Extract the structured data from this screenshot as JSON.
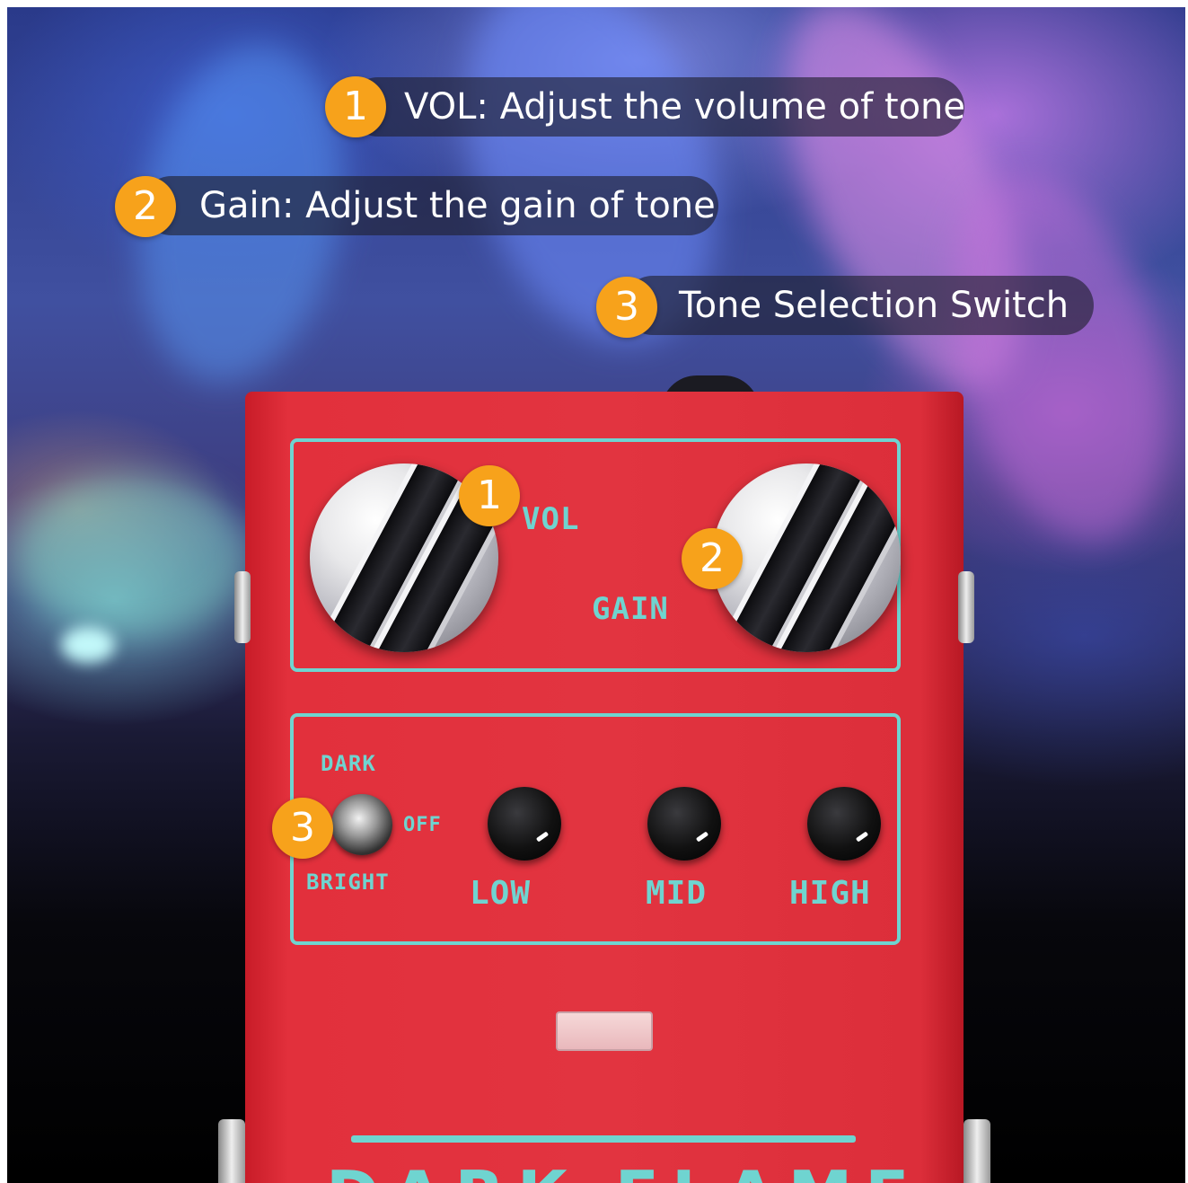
{
  "callouts": [
    {
      "number": "1",
      "text": "VOL: Adjust the volume of tone"
    },
    {
      "number": "2",
      "text": "Gain: Adjust the gain of tone"
    },
    {
      "number": "3",
      "text": "Tone Selection Switch"
    }
  ],
  "pedal": {
    "knob_labels": {
      "vol": "VOL",
      "gain": "GAIN"
    },
    "switch_labels": {
      "dark": "DARK",
      "off": "OFF",
      "bright": "BRIGHT"
    },
    "eq_labels": {
      "low": "LOW",
      "mid": "MID",
      "high": "HIGH"
    },
    "markers": {
      "vol": "1",
      "gain": "2",
      "switch": "3"
    },
    "brand_name": "DARK FLAME"
  },
  "colors": {
    "badge": "#f7a21b",
    "pedal_body": "#e2303c",
    "panel_accent": "#6fd4d0",
    "pill_background": "rgba(30,30,45,0.62)"
  }
}
